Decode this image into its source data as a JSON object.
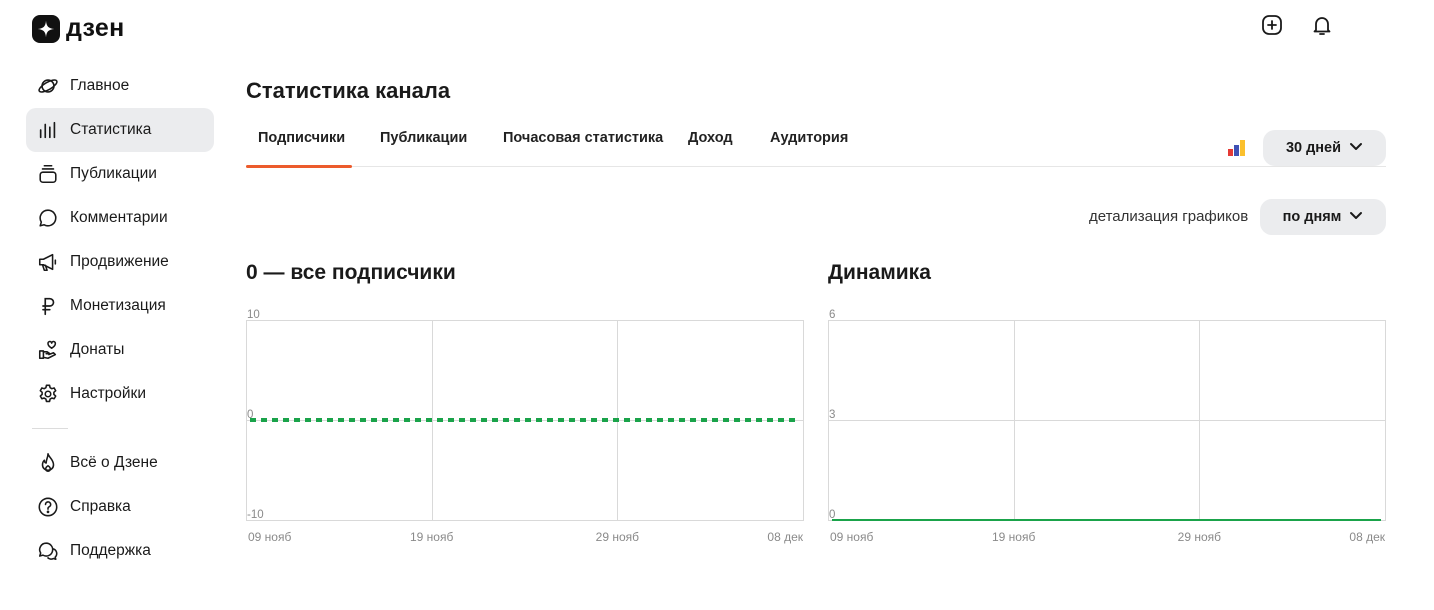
{
  "brand": {
    "name": "дзен"
  },
  "sidebar": {
    "items": [
      {
        "label": "Главное",
        "icon": "planet-icon",
        "active": false
      },
      {
        "label": "Статистика",
        "icon": "bar-chart-icon",
        "active": true
      },
      {
        "label": "Публикации",
        "icon": "stack-icon",
        "active": false
      },
      {
        "label": "Комментарии",
        "icon": "comment-icon",
        "active": false
      },
      {
        "label": "Продвижение",
        "icon": "megaphone-icon",
        "active": false
      },
      {
        "label": "Монетизация",
        "icon": "ruble-icon",
        "active": false
      },
      {
        "label": "Донаты",
        "icon": "hand-heart-icon",
        "active": false
      },
      {
        "label": "Настройки",
        "icon": "gear-icon",
        "active": false
      }
    ],
    "secondary": [
      {
        "label": "Всё о Дзене",
        "icon": "flame-icon"
      },
      {
        "label": "Справка",
        "icon": "help-icon"
      },
      {
        "label": "Поддержка",
        "icon": "chat-bubbles-icon"
      }
    ]
  },
  "page": {
    "title": "Статистика канала"
  },
  "tabs": [
    {
      "label": "Подписчики",
      "active": true
    },
    {
      "label": "Публикации",
      "active": false
    },
    {
      "label": "Почасовая статистика",
      "active": false
    },
    {
      "label": "Доход",
      "active": false
    },
    {
      "label": "Аудитория",
      "active": false
    }
  ],
  "controls": {
    "period": "30 дней",
    "detail_label": "детализация графиков",
    "detail_value": "по дням"
  },
  "colors": {
    "accent": "#ec5b2c",
    "series": "#1aa34a",
    "grid": "#d9d9d9",
    "button_bg": "#ebecee"
  },
  "chart_data": [
    {
      "type": "line",
      "title": "0 — все подписчики",
      "x_ticks": [
        "09 нояб",
        "19 нояб",
        "29 нояб",
        "08 дек"
      ],
      "y_ticks": [
        "10",
        "0",
        "-10"
      ],
      "ylim": [
        -10,
        10
      ],
      "series": [
        {
          "style": "dashed",
          "values": [
            0,
            0,
            0,
            0,
            0,
            0,
            0,
            0,
            0,
            0,
            0,
            0,
            0,
            0,
            0,
            0,
            0,
            0,
            0,
            0,
            0,
            0,
            0,
            0,
            0,
            0,
            0,
            0,
            0,
            0
          ]
        }
      ],
      "grid": true
    },
    {
      "type": "line",
      "title": "Динамика",
      "x_ticks": [
        "09 нояб",
        "19 нояб",
        "29 нояб",
        "08 дек"
      ],
      "y_ticks": [
        "6",
        "3",
        "0"
      ],
      "ylim": [
        0,
        6
      ],
      "series": [
        {
          "style": "solid",
          "values": [
            0,
            0,
            0,
            0,
            0,
            0,
            0,
            0,
            0,
            0,
            0,
            0,
            0,
            0,
            0,
            0,
            0,
            0,
            0,
            0,
            0,
            0,
            0,
            0,
            0,
            0,
            0,
            0,
            0,
            0
          ]
        }
      ],
      "grid": true
    }
  ]
}
